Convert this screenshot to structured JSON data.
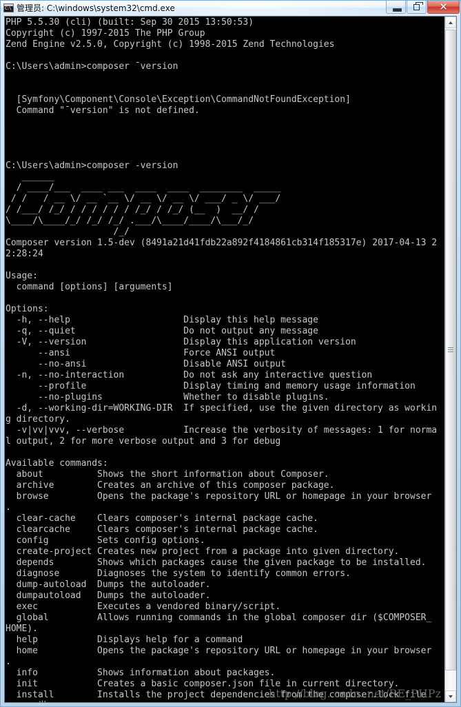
{
  "window": {
    "title": "管理员: C:\\windows\\system32\\cmd.exe",
    "icon": "cmd-icon",
    "buttons": {
      "minimize": "minimize",
      "restore": "restore",
      "close": "✕"
    }
  },
  "scrollbar": {
    "up_arrow": "scroll-up",
    "down_arrow": "scroll-down",
    "thumb": "scroll-thumb"
  },
  "watermark": {
    "text": "http://blog. csdn. net/RE_PHPz"
  },
  "console": {
    "background_color": "#000000",
    "text_color": "#c8c8c8",
    "lines": [
      "PHP 5.5.30 (cli) (built: Sep 30 2015 13:50:53)",
      "Copyright (c) 1997-2015 The PHP Group",
      "Zend Engine v2.5.0, Copyright (c) 1998-2015 Zend Technologies",
      "",
      "C:\\Users\\admin>composer ˉversion",
      "",
      "",
      "  [Symfony\\Component\\Console\\Exception\\CommandNotFoundException]",
      "  Command \"ˉversion\" is not defined.",
      "",
      "",
      "",
      "",
      "C:\\Users\\admin>composer -version",
      "   ______",
      "  / ____/___  ____ ___  ____  ____  ________  _____",
      " / /   / __ \\/ __ `__ \\/ __ \\/ __ \\/ ___/ _ \\/ ___/",
      "/ /___/ /_/ / / / / / / /_/ / /_/ (__  )  __/ /",
      "\\____/\\____/_/ /_/ /_/ .___/\\____/____/\\___/_/",
      "                    /_/",
      "Composer version 1.5-dev (8491a21d41fdb22a892f4184861cb314f185317e) 2017-04-13 2",
      "2:28:24",
      "",
      "Usage:",
      "  command [options] [arguments]",
      "",
      "Options:",
      "  -h, --help                     Display this help message",
      "  -q, --quiet                    Do not output any message",
      "  -V, --version                  Display this application version",
      "      --ansi                     Force ANSI output",
      "      --no-ansi                  Disable ANSI output",
      "  -n, --no-interaction           Do not ask any interactive question",
      "      --profile                  Display timing and memory usage information",
      "      --no-plugins               Whether to disable plugins.",
      "  -d, --working-dir=WORKING-DIR  If specified, use the given directory as workin",
      "g directory.",
      "  -v|vv|vvv, --verbose           Increase the verbosity of messages: 1 for norma",
      "l output, 2 for more verbose output and 3 for debug",
      "",
      "Available commands:",
      "  about          Shows the short information about Composer.",
      "  archive        Creates an archive of this composer package.",
      "  browse         Opens the package's repository URL or homepage in your browser",
      ".",
      "  clear-cache    Clears composer's internal package cache.",
      "  clearcache     Clears composer's internal package cache.",
      "  config         Sets config options.",
      "  create-project Creates new project from a package into given directory.",
      "  depends        Shows which packages cause the given package to be installed.",
      "  diagnose       Diagnoses the system to identify common errors.",
      "  dump-autoload  Dumps the autoloader.",
      "  dumpautoload   Dumps the autoloader.",
      "  exec           Executes a vendored binary/script.",
      "  global         Allows running commands in the global composer dir ($COMPOSER_",
      "HOME).",
      "  help           Displays help for a command",
      "  home           Opens the package's repository URL or homepage in your browser",
      ".",
      "  info           Shows information about packages.",
      "  init           Creates a basic composer.json file in current directory.",
      "  install        Installs the project dependencies from the composer.lock file",
      "      半:"
    ]
  }
}
